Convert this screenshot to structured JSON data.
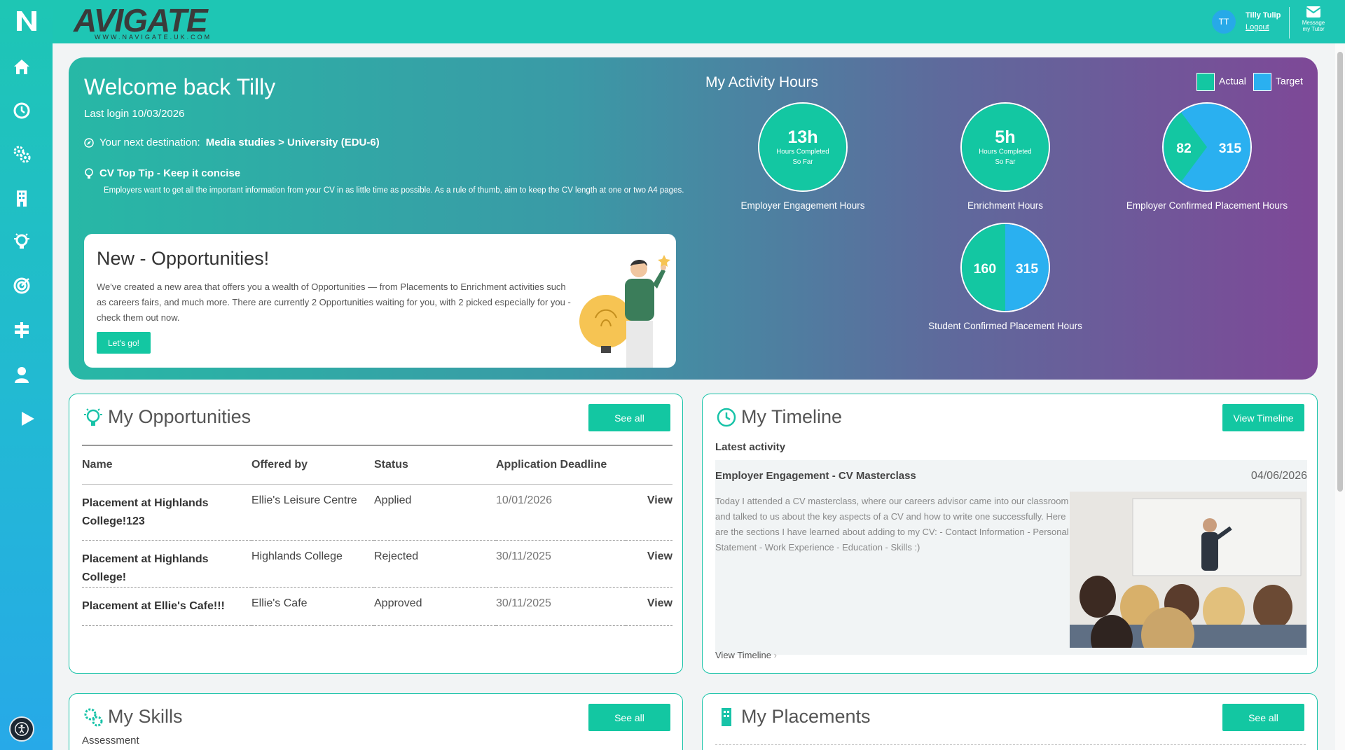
{
  "app": {
    "brand_word": "AVIGATE",
    "brand_url": "WWW.NAVIGATE.UK.COM",
    "logo_letter": "N"
  },
  "user": {
    "initials": "TT",
    "name": "Tilly Tulip",
    "logout": "Logout",
    "message_label": "Message my Tutor"
  },
  "sidebar": {
    "items": [
      {
        "name": "home",
        "icon": "home-icon"
      },
      {
        "name": "timeline",
        "icon": "clock-icon"
      },
      {
        "name": "skills",
        "icon": "gears-icon"
      },
      {
        "name": "placements",
        "icon": "building-icon"
      },
      {
        "name": "opportunities",
        "icon": "lightbulb-icon"
      },
      {
        "name": "goals",
        "icon": "target-icon"
      },
      {
        "name": "destinations",
        "icon": "signpost-icon"
      },
      {
        "name": "profile",
        "icon": "person-icon"
      },
      {
        "name": "expand",
        "icon": "play-icon"
      }
    ],
    "accessibility": "accessibility-icon"
  },
  "hero": {
    "welcome": "Welcome back Tilly",
    "last_login": "Last login 10/03/2026",
    "dest_prefix": "Your next destination:",
    "dest_value": "Media studies > University (EDU-6)",
    "tip_title": "CV Top Tip - Keep it concise",
    "tip_body": "Employers want to get all the important information from your CV in as little time as possible. As a rule of thumb, aim to keep the CV length at one or two A4 pages.",
    "opp_title": "New - Opportunities!",
    "opp_body": "We've created a new area that offers you a wealth of Opportunities — from Placements to Enrichment activities such as careers fairs, and much more. There are currently 2 Opportunities waiting for you, with 2 picked especially for you - check them out now.",
    "opp_button": "Let's go!"
  },
  "activity": {
    "title": "My Activity Hours",
    "legend_actual": "Actual",
    "legend_target": "Target",
    "colors": {
      "actual": "#13c7a2",
      "target": "#2ab0f0"
    },
    "gauges": [
      {
        "label": "Employer Engagement Hours",
        "big": "13h",
        "small": "Hours Completed So Far",
        "kind": "single"
      },
      {
        "label": "Enrichment Hours",
        "big": "5h",
        "small": "Hours Completed So Far",
        "kind": "single"
      },
      {
        "label": "Employer Confirmed Placement Hours",
        "actual": "82",
        "target": "315",
        "kind": "split"
      },
      {
        "label": "Student Confirmed Placement Hours",
        "actual": "160",
        "target": "315",
        "kind": "split"
      }
    ]
  },
  "opportunities": {
    "title": "My Opportunities",
    "see_all": "See all",
    "columns": [
      "Name",
      "Offered by",
      "Status",
      "Application Deadline",
      ""
    ],
    "rows": [
      {
        "name": "Placement at Highlands College!123",
        "offered_by": "Ellie's Leisure Centre",
        "status": "Applied",
        "deadline": "10/01/2026",
        "action": "View"
      },
      {
        "name": "Placement at Highlands College!",
        "offered_by": "Highlands College",
        "status": "Rejected",
        "deadline": "30/11/2025",
        "action": "View"
      },
      {
        "name": "Placement at Ellie's Cafe!!!",
        "offered_by": "Ellie's Cafe",
        "status": "Approved",
        "deadline": "30/11/2025",
        "action": "View"
      }
    ]
  },
  "timeline": {
    "title": "My Timeline",
    "button": "View Timeline",
    "subtitle": "Latest activity",
    "entry_title": "Employer Engagement - CV Masterclass",
    "entry_date": "04/06/2026",
    "entry_body": "Today I attended a CV masterclass, where our careers advisor came into our classroom and talked to us about the key aspects of a CV and how to write one successfully. Here are the sections I have learned about adding to my CV: - Contact Information - Personal Statement - Work Experience - Education - Skills :)",
    "link": "View Timeline"
  },
  "skills": {
    "title": "My Skills",
    "see_all": "See all",
    "subtitle": "Assessment"
  },
  "placements": {
    "title": "My Placements",
    "see_all": "See all"
  }
}
